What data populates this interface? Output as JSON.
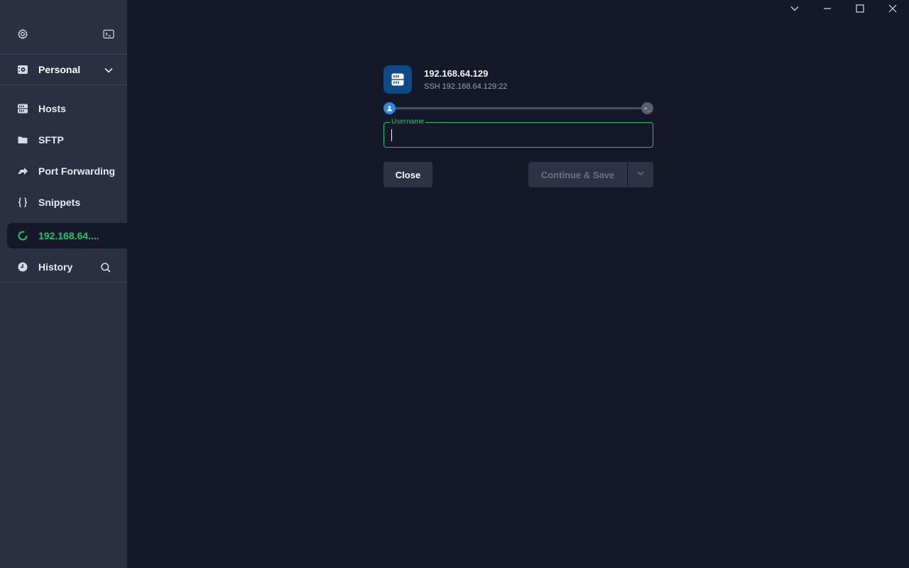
{
  "window": {
    "controls": [
      "chevron-down-icon",
      "minimize-icon",
      "maximize-icon",
      "close-icon"
    ]
  },
  "sidebar": {
    "top_icons": [
      "gear-icon",
      "terminal-icon"
    ],
    "vault": {
      "label": "Personal"
    },
    "items": [
      {
        "label": "Hosts",
        "icon": "hosts-icon"
      },
      {
        "label": "SFTP",
        "icon": "folder-icon"
      },
      {
        "label": "Port Forwarding",
        "icon": "port-forward-icon"
      },
      {
        "label": "Snippets",
        "icon": "braces-icon"
      },
      {
        "label": "192.168.64....",
        "icon": "spinner-icon",
        "active": true
      }
    ],
    "history": {
      "label": "History"
    }
  },
  "connection": {
    "title": "192.168.64.129",
    "subtitle": "SSH 192.168.64.129:22",
    "progress_end_glyph": ">_",
    "username": {
      "label": "Username",
      "value": ""
    },
    "close_label": "Close",
    "continue_label": "Continue & Save"
  },
  "colors": {
    "accent": "#21c36b",
    "sidebar_bg": "#2b2f42",
    "main_bg": "#151829",
    "host_icon_bg": "#0e4a86",
    "progress_start": "#2f86e3"
  }
}
